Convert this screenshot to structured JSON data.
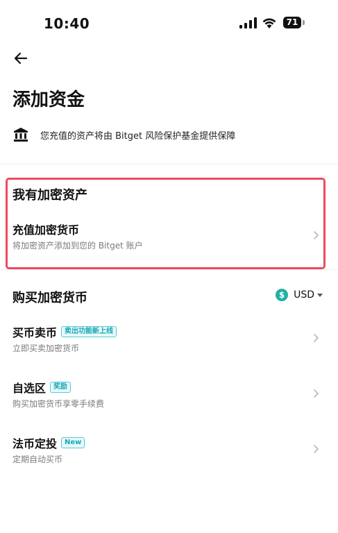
{
  "status_bar": {
    "time": "10:40",
    "battery": "71"
  },
  "page": {
    "title": "添加资金"
  },
  "notice": {
    "text": "您充值的资产将由 Bitget 风险保护基金提供保障",
    "icon": "bank-icon"
  },
  "crypto_section": {
    "title": "我有加密资产",
    "item": {
      "title": "充值加密货币",
      "subtitle": "将加密资产添加到您的 Bitget 账户"
    }
  },
  "buy_section": {
    "title": "购买加密货币",
    "currency": {
      "symbol": "$",
      "label": "USD"
    },
    "items": [
      {
        "title": "买币卖币",
        "tag": "卖出功能新上线",
        "subtitle": "立即买卖加密货币"
      },
      {
        "title": "自选区",
        "tag": "奖励",
        "subtitle": "购买加密货币享零手续费"
      },
      {
        "title": "法币定投",
        "tag": "New",
        "subtitle": "定期自动买币"
      }
    ]
  },
  "colors": {
    "highlight": "#ee4a5e",
    "tag": "#18a9b5",
    "coin": "#21b0a5"
  }
}
